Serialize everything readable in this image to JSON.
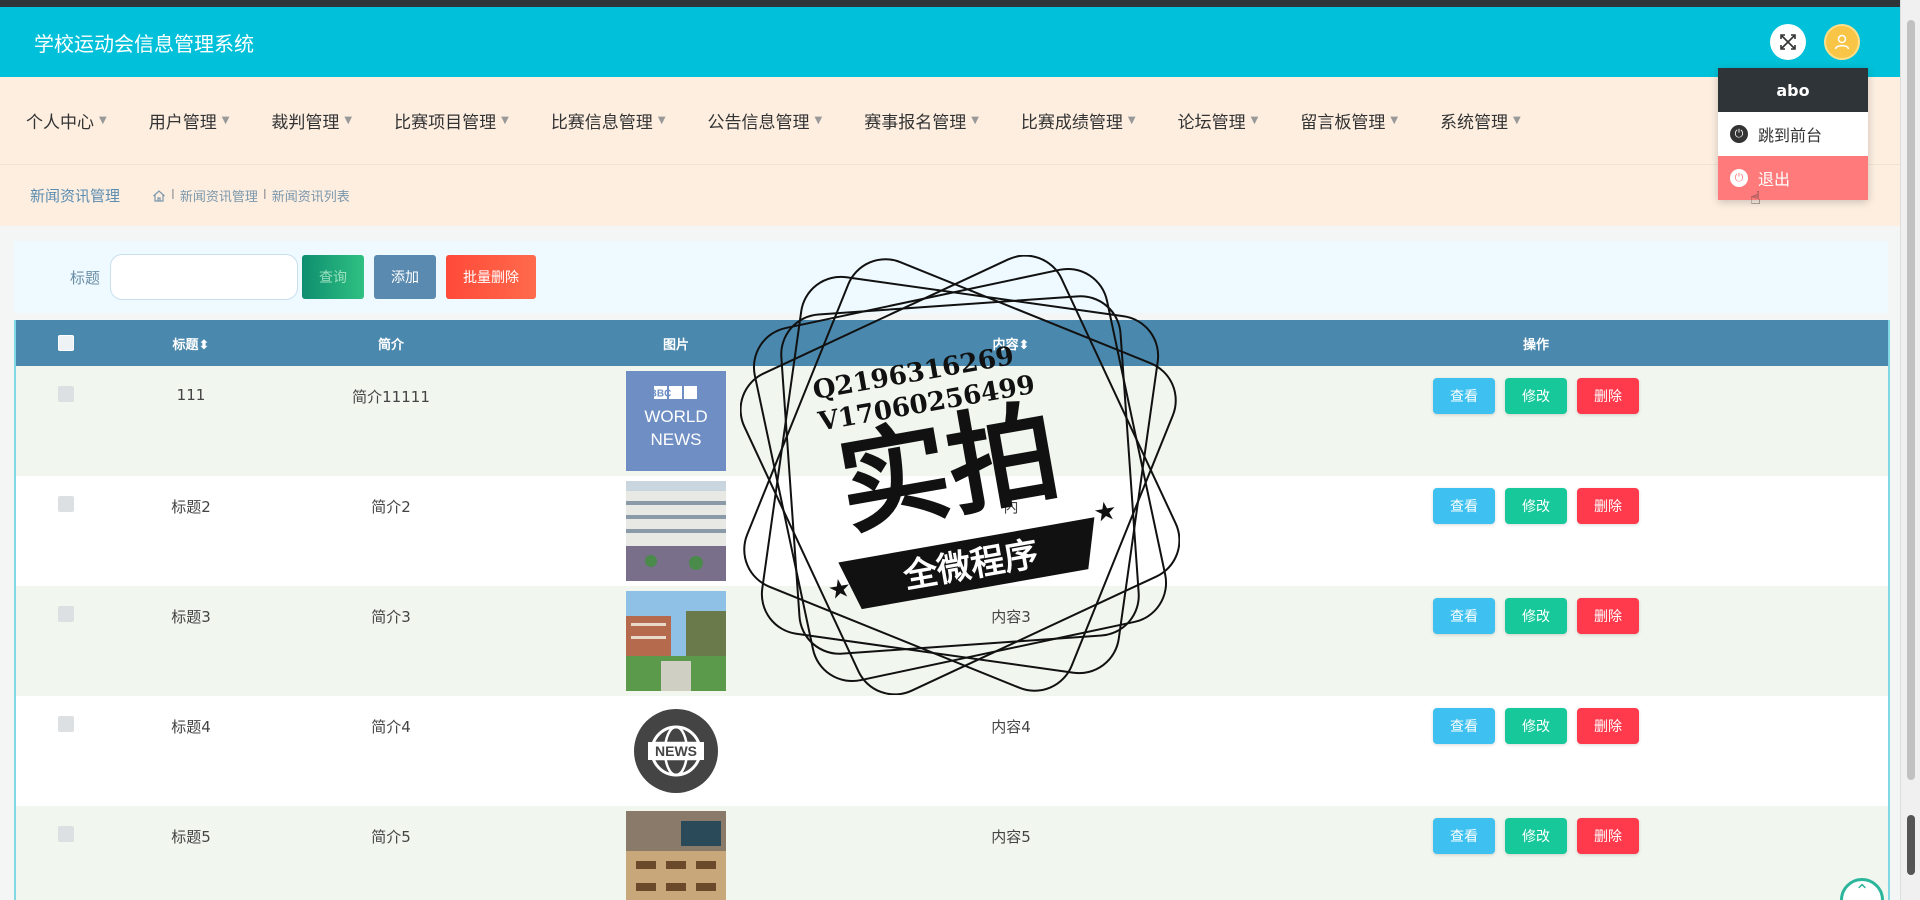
{
  "app": {
    "title": "学校运动会信息管理系统"
  },
  "header": {
    "fullscreen_icon": "fullscreen-icon",
    "avatar_icon": "user-icon",
    "accent": "#00c1d9"
  },
  "nav": {
    "items": [
      {
        "label": "个人中心"
      },
      {
        "label": "用户管理"
      },
      {
        "label": "裁判管理"
      },
      {
        "label": "比赛项目管理"
      },
      {
        "label": "比赛信息管理"
      },
      {
        "label": "公告信息管理"
      },
      {
        "label": "赛事报名管理"
      },
      {
        "label": "比赛成绩管理"
      },
      {
        "label": "论坛管理"
      },
      {
        "label": "留言板管理"
      },
      {
        "label": "系统管理"
      }
    ]
  },
  "breadcrumb": {
    "section": "新闻资讯管理",
    "path": [
      "新闻资讯管理",
      "新闻资讯列表"
    ],
    "separator": "I"
  },
  "search": {
    "label": "标题",
    "value": "",
    "search_btn": "查询",
    "add_btn": "添加",
    "batch_delete_btn": "批量删除"
  },
  "table": {
    "headers": {
      "title": "标题",
      "intro": "简介",
      "image": "图片",
      "content": "内容",
      "ops": "操作"
    },
    "rows": [
      {
        "title": "111",
        "intro": "简介11111",
        "image": "bbc-world-news",
        "image_text": [
          "BBC",
          "WORLD",
          "NEWS"
        ],
        "content": ""
      },
      {
        "title": "标题2",
        "intro": "简介2",
        "image": "campus-building",
        "content": "内"
      },
      {
        "title": "标题3",
        "intro": "简介3",
        "image": "campus-garden",
        "content": "内容3"
      },
      {
        "title": "标题4",
        "intro": "简介4",
        "image": "news-globe",
        "image_text": [
          "NEWS"
        ],
        "content": "内容4"
      },
      {
        "title": "标题5",
        "intro": "简介5",
        "image": "classroom",
        "content": "内容5"
      }
    ],
    "ops": {
      "view": "查看",
      "edit": "修改",
      "delete": "删除"
    }
  },
  "dropdown": {
    "username": "abo",
    "goto_front": "跳到前台",
    "logout": "退出"
  },
  "watermark": {
    "line1": "Q2196316269",
    "line2": "V17060256499",
    "main": "实拍",
    "banner": "全微程序"
  }
}
